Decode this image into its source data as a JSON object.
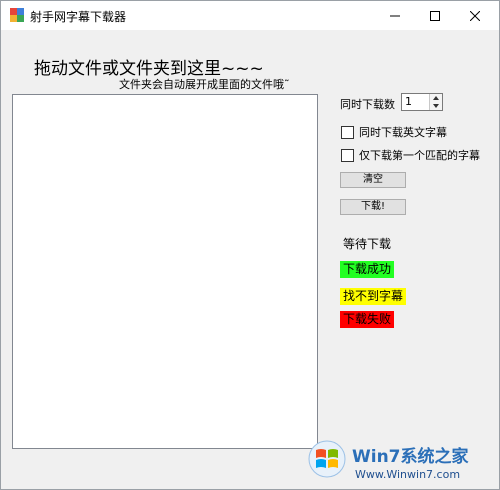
{
  "window": {
    "title": "射手网字幕下载器"
  },
  "drop_area": {
    "heading": "拖动文件或文件夹到这里~~~",
    "subheading": "文件夹会自动展开成里面的文件哦˜"
  },
  "settings": {
    "concurrent_label": "同时下载数",
    "concurrent_value": "1",
    "english_checkbox_label": "同时下载英文字幕",
    "first_match_checkbox_label": "仅下载第一个匹配的字幕"
  },
  "buttons": {
    "clear_label": "清空",
    "download_label": "下载!"
  },
  "legend": {
    "waiting": "等待下载",
    "success": "下载成功",
    "not_found": "找不到字幕",
    "failed": "下载失败",
    "colors": {
      "success": "#22ff22",
      "not_found": "#ffff00",
      "failed": "#ff0000"
    }
  },
  "watermark": {
    "title": "Win7系统之家",
    "url": "Www.Winwin7.com"
  }
}
